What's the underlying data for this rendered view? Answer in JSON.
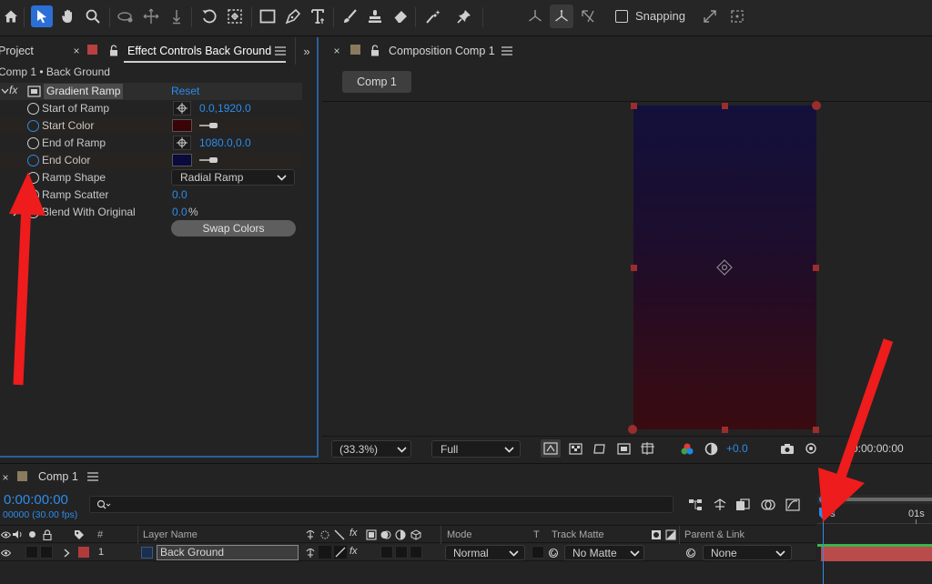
{
  "toolbar": {
    "snapping_label": "Snapping",
    "snapping_checked": false
  },
  "left_panel": {
    "tab_project": "Project",
    "tab_effect_controls": "Effect Controls Back Ground",
    "breadcrumb": "Comp 1 • Back Ground",
    "effect": {
      "fx_label": "fx",
      "name": "Gradient Ramp",
      "reset_label": "Reset"
    },
    "properties": [
      {
        "label": "Start of Ramp",
        "value": "0.0,1920.0",
        "kind": "point"
      },
      {
        "label": "Start Color",
        "color": "#3a0306",
        "kind": "color"
      },
      {
        "label": "End of Ramp",
        "value": "1080.0,0.0",
        "kind": "point"
      },
      {
        "label": "End Color",
        "color": "#0a0a3c",
        "kind": "color"
      },
      {
        "label": "Ramp Shape",
        "value": "Radial Ramp",
        "kind": "dropdown"
      },
      {
        "label": "Ramp Scatter",
        "value": "0.0",
        "kind": "number"
      },
      {
        "label": "Blend With Original",
        "value": "0.0",
        "unit": "%",
        "kind": "percent"
      }
    ],
    "swap_colors_label": "Swap Colors"
  },
  "composition_panel": {
    "tab_label": "Composition Comp 1",
    "comp_button": "Comp 1",
    "gradient": {
      "top": "#12103c",
      "bottom": "#3a0b10"
    },
    "footer": {
      "zoom": "(33.3%)",
      "resolution": "Full",
      "exposure": "+0.0",
      "timecode": "0:00:00:00"
    }
  },
  "timeline": {
    "tab_label": "Comp 1",
    "timecode": "0:00:00:00",
    "frame_info": "00000 (30.00 fps)",
    "search_placeholder": "",
    "columns": {
      "hash": "#",
      "layer_name": "Layer Name",
      "mode": "Mode",
      "t": "T",
      "track_matte": "Track Matte",
      "parent_link": "Parent & Link"
    },
    "layers": [
      {
        "number": "1",
        "name": "Back Ground",
        "mode": "Normal",
        "track_matte": "No Matte",
        "parent": "None",
        "label_color": "#b33a3a"
      }
    ],
    "ruler": {
      "start": "0s",
      "mark": "01s"
    }
  },
  "colors": {
    "accent": "#2d8ceb",
    "arrow": "#ee1c1c",
    "layer_bar": "#b94b4b"
  }
}
